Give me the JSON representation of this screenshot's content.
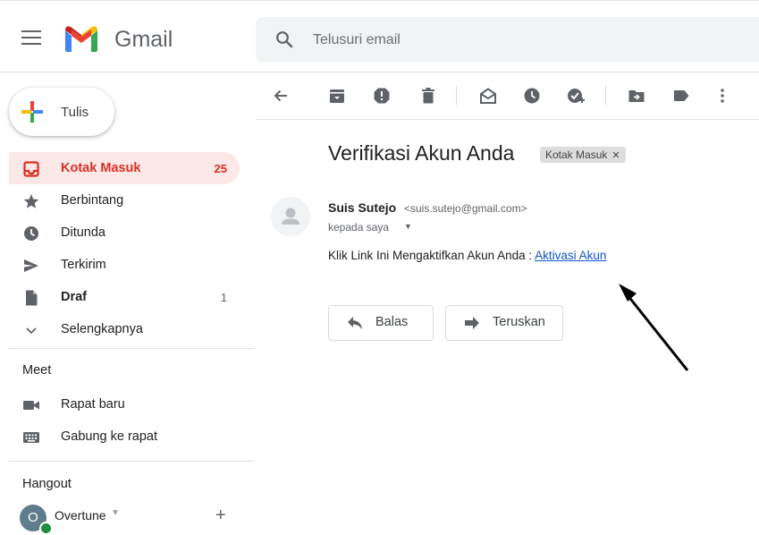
{
  "header": {
    "brand": "Gmail",
    "search_placeholder": "Telusuri email"
  },
  "compose": {
    "label": "Tulis"
  },
  "sidebar": {
    "items": [
      {
        "label": "Kotak Masuk",
        "count": "25",
        "icon": "inbox-icon"
      },
      {
        "label": "Berbintang",
        "count": "",
        "icon": "star-icon"
      },
      {
        "label": "Ditunda",
        "count": "",
        "icon": "clock-icon"
      },
      {
        "label": "Terkirim",
        "count": "",
        "icon": "send-icon"
      },
      {
        "label": "Draf",
        "count": "1",
        "icon": "draft-icon"
      },
      {
        "label": "Selengkapnya",
        "count": "",
        "icon": "chevron-down-icon"
      }
    ]
  },
  "meet": {
    "title": "Meet",
    "items": [
      {
        "label": "Rapat baru",
        "icon": "video-camera-icon"
      },
      {
        "label": "Gabung ke rapat",
        "icon": "keyboard-icon"
      }
    ]
  },
  "hangout": {
    "title": "Hangout",
    "avatar_initial": "O",
    "user": "Overtune"
  },
  "message": {
    "subject": "Verifikasi Akun Anda",
    "label_chip": "Kotak Masuk",
    "sender_name": "Suis Sutejo",
    "sender_email": "<suis.sutejo@gmail.com>",
    "recipient": "kepada saya",
    "body_text": "Klik Link Ini Mengaktifkan Akun Anda : ",
    "link_text": "Aktivasi Akun"
  },
  "actions": {
    "reply": "Balas",
    "forward": "Teruskan"
  },
  "colors": {
    "accent_red": "#d93025",
    "link_blue": "#1155cc",
    "active_bg": "#fce8e6"
  }
}
